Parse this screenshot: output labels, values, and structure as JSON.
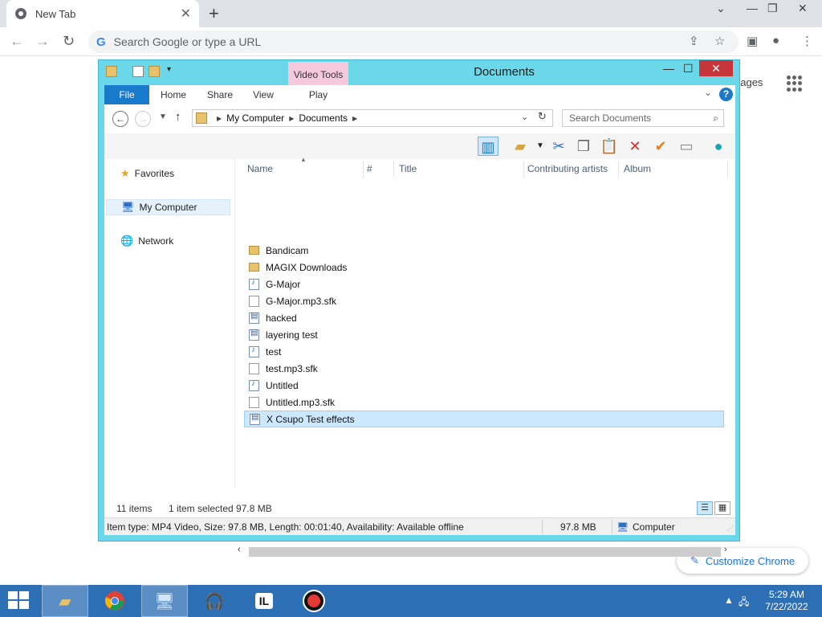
{
  "chrome": {
    "tab_title": "New Tab",
    "tab_close": "✕",
    "new_tab": "+",
    "omnibox_placeholder": "Search Google or type a URL",
    "images_link": "nages",
    "customize_label": "Customize Chrome"
  },
  "explorer": {
    "title": "Documents",
    "context_tab": "Video Tools",
    "ribbon_tabs": [
      "File",
      "Home",
      "Share",
      "View",
      "Play"
    ],
    "address": {
      "crumbs": [
        "My Computer",
        "Documents"
      ]
    },
    "search_placeholder": "Search Documents",
    "nav_pane": [
      {
        "label": "Favorites",
        "icon": "star-icon"
      },
      {
        "label": "My Computer",
        "icon": "computer-icon"
      },
      {
        "label": "Network",
        "icon": "network-icon"
      }
    ],
    "columns": [
      "Name",
      "#",
      "Title",
      "Contributing artists",
      "Album"
    ],
    "files": [
      {
        "name": "Bandicam",
        "type": "folder"
      },
      {
        "name": "MAGIX Downloads",
        "type": "folder"
      },
      {
        "name": "G-Major",
        "type": "audio"
      },
      {
        "name": "G-Major.mp3.sfk",
        "type": "blank"
      },
      {
        "name": "hacked",
        "type": "video"
      },
      {
        "name": "layering test",
        "type": "video"
      },
      {
        "name": "test",
        "type": "audio"
      },
      {
        "name": "test.mp3.sfk",
        "type": "blank"
      },
      {
        "name": "Untitled",
        "type": "audio"
      },
      {
        "name": "Untitled.mp3.sfk",
        "type": "blank"
      },
      {
        "name": "X Csupo Test effects",
        "type": "video",
        "selected": true
      }
    ],
    "status": {
      "item_count": "11 items",
      "selection": "1 item selected  97.8 MB"
    },
    "details": {
      "info": "Item type: MP4 Video, Size: 97.8 MB, Length: 00:01:40, Availability: Available offline",
      "size": "97.8 MB",
      "location": "Computer"
    }
  },
  "taskbar": {
    "time": "5:29 AM",
    "date": "7/22/2022"
  },
  "colors": {
    "explorer_frame": "#6ad8e8",
    "file_tab": "#1979ca",
    "video_tools": "#f6c8dc",
    "taskbar": "#2c6fb5",
    "selection": "#cce8ff"
  }
}
